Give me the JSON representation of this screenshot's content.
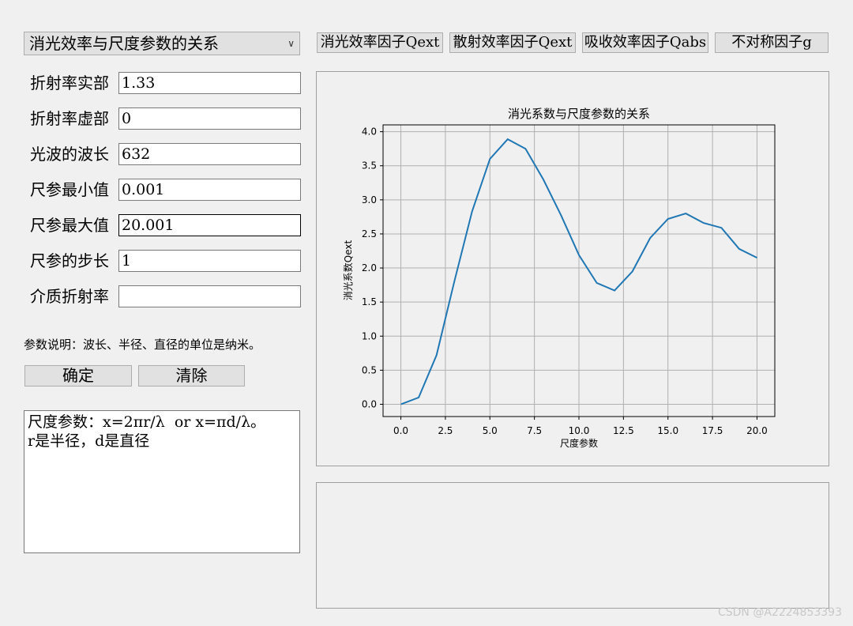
{
  "mode_select": {
    "value": "消光效率与尺度参数的关系"
  },
  "top_buttons": [
    "消光效率因子Qext",
    "散射效率因子Qext",
    "吸收效率因子Qabs",
    "不对称因子g"
  ],
  "fields": [
    {
      "label": "折射率实部",
      "value": "1.33"
    },
    {
      "label": "折射率虚部",
      "value": "0"
    },
    {
      "label": "光波的波长",
      "value": "632"
    },
    {
      "label": "尺参最小值",
      "value": "0.001"
    },
    {
      "label": "尺参最大值",
      "value": "20.001"
    },
    {
      "label": "尺参的步长",
      "value": "1"
    },
    {
      "label": "介质折射率",
      "value": ""
    }
  ],
  "note": "参数说明：波长、半径、直径的单位是纳米。",
  "actions": {
    "confirm": "确定",
    "clear": "清除"
  },
  "info_text": "尺度参数：x=2πr/λ  or x=πd/λ。\nr是半径，d是直径",
  "watermark": "CSDN @A2224853393",
  "chart_data": {
    "type": "line",
    "title": "消光系数与尺度参数的关系",
    "xlabel": "尺度参数",
    "ylabel": "消光系数Qext",
    "x": [
      0.001,
      1.001,
      2.001,
      3.001,
      4.001,
      5.001,
      6.001,
      7.001,
      8.001,
      9.001,
      10.001,
      11.001,
      12.001,
      13.001,
      14.001,
      15.001,
      16.001,
      17.001,
      18.001,
      19.001,
      20.001
    ],
    "series": [
      {
        "values": [
          0.0,
          0.1,
          0.72,
          1.8,
          2.83,
          3.6,
          3.89,
          3.75,
          3.3,
          2.77,
          2.19,
          1.78,
          1.67,
          1.95,
          2.44,
          2.72,
          2.8,
          2.66,
          2.59,
          2.28,
          2.15
        ]
      }
    ],
    "xlim": [
      -1.0,
      21.0
    ],
    "ylim": [
      -0.18,
      4.1
    ],
    "xticks": [
      "0.0",
      "2.5",
      "5.0",
      "7.5",
      "10.0",
      "12.5",
      "15.0",
      "17.5",
      "20.0"
    ],
    "yticks": [
      "0.0",
      "0.5",
      "1.0",
      "1.5",
      "2.0",
      "2.5",
      "3.0",
      "3.5",
      "4.0"
    ],
    "grid": true,
    "line_color": "#1f77b4"
  }
}
